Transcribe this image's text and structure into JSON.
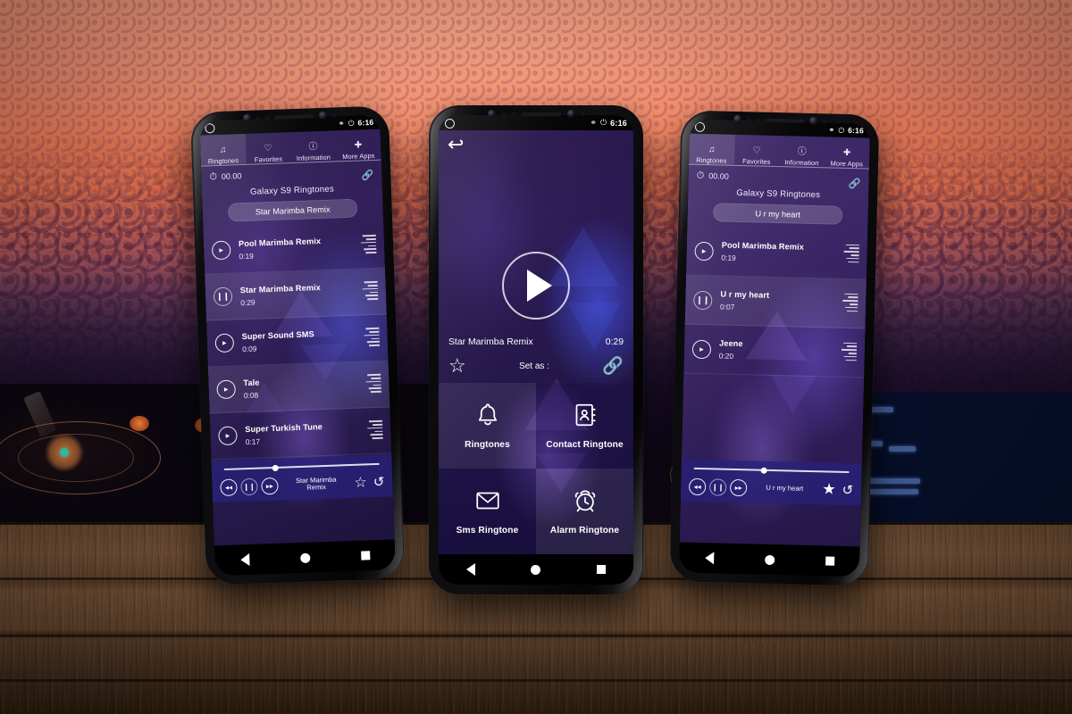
{
  "scene": {
    "background": "concert-crowd-sunset-with-dj-decks-on-wooden-table",
    "colors": {
      "sky_orange": "#f8855f",
      "sky_purple": "#2a1c3c",
      "wood": "#6b4a30",
      "app_purple": "#2c1b50",
      "accent_blue": "#5660eb"
    }
  },
  "status_bar": {
    "time": "6:16",
    "icons": [
      "silent-mode-icon",
      "battery-icon"
    ]
  },
  "tabs": [
    {
      "label": "Ringtones",
      "icon": "music-note-icon",
      "active": true
    },
    {
      "label": "Favorites",
      "icon": "heart-icon",
      "active": false
    },
    {
      "label": "Information",
      "icon": "info-circle-icon",
      "active": false
    },
    {
      "label": "More Apps",
      "icon": "plus-cross-icon",
      "active": false
    }
  ],
  "nav_bar": {
    "back": "back-triangle",
    "home": "home-circle",
    "recents": "recents-square"
  },
  "phone_left": {
    "timer": "00.00",
    "share_icon": "share-icon",
    "category_title": "Galaxy S9 Ringtones",
    "selected_pill": "Star Marimba Remix",
    "tracks": [
      {
        "name": "Pool Marimba Remix",
        "duration": "0:19",
        "state": "play"
      },
      {
        "name": "Star Marimba Remix",
        "duration": "0:29",
        "state": "pause"
      },
      {
        "name": "Super Sound SMS",
        "duration": "0:09",
        "state": "play"
      },
      {
        "name": "Tale",
        "duration": "0:08",
        "state": "play"
      },
      {
        "name": "Super Turkish Tune",
        "duration": "0:17",
        "state": "play"
      }
    ],
    "player": {
      "title": "Star Marimba Remix",
      "progress_percent": 31,
      "rewind": "rewind-icon",
      "pause": "pause-icon",
      "forward": "forward-icon",
      "favorite": "star-outline-icon",
      "timer": "sleep-timer-icon"
    }
  },
  "phone_center": {
    "back_icon": "back-arrow-icon",
    "play_icon": "play-icon",
    "now_playing": "Star Marimba Remix",
    "duration": "0:29",
    "favorite_icon": "star-outline-icon",
    "set_as_label": "Set as :",
    "share_icon": "share-icon",
    "tiles": [
      {
        "label": "Ringtones",
        "icon": "bell-icon"
      },
      {
        "label": "Contact Ringtone",
        "icon": "contact-book-icon"
      },
      {
        "label": "Sms Ringtone",
        "icon": "envelope-icon"
      },
      {
        "label": "Alarm Ringtone",
        "icon": "alarm-clock-icon"
      }
    ]
  },
  "phone_right": {
    "timer": "00.00",
    "share_icon": "share-icon",
    "category_title": "Galaxy S9 Ringtones",
    "selected_pill": "U r my heart",
    "tracks": [
      {
        "name": "Pool Marimba Remix",
        "duration": "0:19",
        "state": "play"
      },
      {
        "name": "U r my heart",
        "duration": "0:07",
        "state": "pause"
      },
      {
        "name": "Jeene",
        "duration": "0:20",
        "state": "play"
      }
    ],
    "player": {
      "title": "U r my heart",
      "progress_percent": 43,
      "rewind": "rewind-icon",
      "pause": "pause-icon",
      "forward": "forward-icon",
      "favorite": "star-filled-icon",
      "timer": "sleep-timer-icon"
    }
  }
}
